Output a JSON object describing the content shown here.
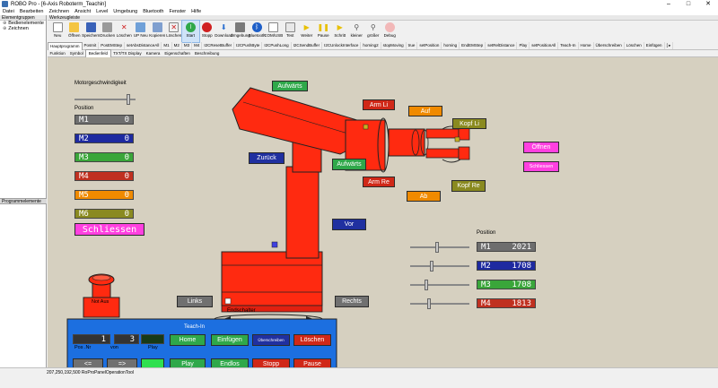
{
  "window": {
    "title": "ROBO Pro - [6-Axis Roboterm_Teachin]",
    "controls": [
      "–",
      "□",
      "✕"
    ]
  },
  "menu": [
    "Datei",
    "Bearbeiten",
    "Zeichnen",
    "Ansicht",
    "Level",
    "Umgebung",
    "Bluetooth",
    "Fenster",
    "Hilfe"
  ],
  "left_panel": {
    "header": "Elementgruppen",
    "items": [
      {
        "label": "Bedienelemente",
        "expander": "⊕"
      },
      {
        "label": "Zeichnen",
        "expander": "⊕"
      }
    ],
    "splitter_label": "Programmelemente"
  },
  "toolbar": {
    "header": "Werkzeugleiste",
    "buttons": [
      {
        "label": "Neu",
        "icon": "new-icon"
      },
      {
        "label": "Öffnen",
        "icon": "open-icon"
      },
      {
        "label": "Speichern",
        "icon": "save-icon"
      },
      {
        "label": "Drucken",
        "icon": "print-icon"
      },
      {
        "label": "Löschen",
        "icon": "delete-icon"
      },
      {
        "label": "UP Neu",
        "icon": "new-subprogram-icon"
      },
      {
        "label": "Kopieren",
        "icon": "copy-icon"
      },
      {
        "label": "Löschen",
        "icon": "delete-subprogram-icon"
      },
      {
        "label": "Start",
        "icon": "start-icon",
        "selected": true
      },
      {
        "label": "Stopp",
        "icon": "stop-icon"
      },
      {
        "label": "Download",
        "icon": "download-icon"
      },
      {
        "label": "Umgebung",
        "icon": "environment-icon"
      },
      {
        "label": "Bluetooth",
        "icon": "bluetooth-icon"
      },
      {
        "label": "COM/USB",
        "icon": "com-usb-icon"
      },
      {
        "label": "Test",
        "icon": "test-icon"
      },
      {
        "label": "Weiter",
        "icon": "continue-icon"
      },
      {
        "label": "Pause",
        "icon": "pause-icon"
      },
      {
        "label": "Schritt",
        "icon": "step-icon"
      },
      {
        "label": "kleiner",
        "icon": "zoom-out-icon"
      },
      {
        "label": "größer",
        "icon": "zoom-in-icon"
      },
      {
        "label": "Debug",
        "icon": "debug-icon"
      }
    ]
  },
  "tabs_top": [
    "Hauptprogramm",
    "PosInit",
    "PosEMStep",
    "setAbsDistanceAll",
    "M1",
    "M2",
    "M3",
    "M4",
    "I2CResetBuffer",
    "I2CPushByte",
    "I2CPushLong",
    "I2CSendBuffer",
    "I2CUnlockInterface",
    "homing2",
    "stopMoving",
    "true",
    "setPosition",
    "homing",
    "EndEMStep",
    "setRelDistance",
    "Play",
    "setPositionAll",
    "Teach-In",
    "Home",
    "Überschreiben",
    "Löschen",
    "Einfügen",
    "[ ▸"
  ],
  "tabs_bottom": [
    {
      "label": "Funktion"
    },
    {
      "label": "Symbol"
    },
    {
      "label": "Bedienfeld",
      "active": true
    },
    {
      "label": "TXT/TX Display"
    },
    {
      "label": "Kamera"
    },
    {
      "label": "Eigenschaften"
    },
    {
      "label": "Beschreibung"
    }
  ],
  "panel": {
    "motor_speed_label": "Motorgeschwindigkeit",
    "motor_speed": 0.9,
    "position_label": "Position",
    "left_displays": [
      {
        "name": "M1",
        "value": "0",
        "color": "#6e6e6e"
      },
      {
        "name": "M2",
        "value": "0",
        "color": "#1e2aa0"
      },
      {
        "name": "M3",
        "value": "0",
        "color": "#3aa63a"
      },
      {
        "name": "M4",
        "value": "0",
        "color": "#c03020"
      },
      {
        "name": "M5",
        "value": "0",
        "color": "#f08a00"
      },
      {
        "name": "M6",
        "value": "0",
        "color": "#8a8a20"
      }
    ],
    "gripper_state": "Schliessen",
    "arm_buttons": {
      "aufwaerts_top": "Aufwärts",
      "arm_li": "Arm Li",
      "auf": "Auf",
      "kopf_li": "Kopf Li",
      "oeffnen": "Öffnen",
      "schliessen": "Schliessen",
      "zurueck": "Zurück",
      "aufwaerts_mid": "Aufwärts",
      "arm_re": "Arm Re",
      "ab": "Ab",
      "kopf_re": "Kopf Re",
      "vor": "Vor",
      "links": "Links",
      "rechts": "Rechts",
      "endschalter": "Endschalter"
    },
    "not_aus": "Not Aus",
    "right_position_label": "Position",
    "right_displays": [
      {
        "name": "M1",
        "value": "2021",
        "color": "#6e6e6e",
        "slider": 0.45
      },
      {
        "name": "M2",
        "value": "1708",
        "color": "#1e2aa0",
        "slider": 0.35
      },
      {
        "name": "M3",
        "value": "1708",
        "color": "#3aa63a",
        "slider": 0.25
      },
      {
        "name": "M4",
        "value": "1813",
        "color": "#c03020",
        "slider": 0.3
      }
    ],
    "teachin": {
      "header": "Teach-In",
      "pos": "1",
      "total": "3",
      "pos_label": "Pos .Nr",
      "von_label": "von",
      "play_label": "Play",
      "prev": "<=",
      "next": "=>",
      "home": "Home",
      "einfuegen": "Einfügen",
      "ueberschreiben": "Überschreiben",
      "loeschen": "Löschen",
      "play": "Play",
      "endlos": "Endlos",
      "stopp": "Stopp",
      "pause": "Pause"
    }
  },
  "status_bar": "207,250,192,500 RoProPanelOperationTool",
  "colors": {
    "robot_red": "#ff2a10",
    "panel_bg": "#d6d0c0",
    "teachin_blue": "#1c6fe0",
    "btn_green": "#2fa84a",
    "btn_red": "#d02818",
    "btn_blue": "#2030a0",
    "btn_orange": "#f08a00",
    "btn_olive": "#8a8a20",
    "btn_magenta": "#ff40e0",
    "btn_gray": "#707070"
  }
}
